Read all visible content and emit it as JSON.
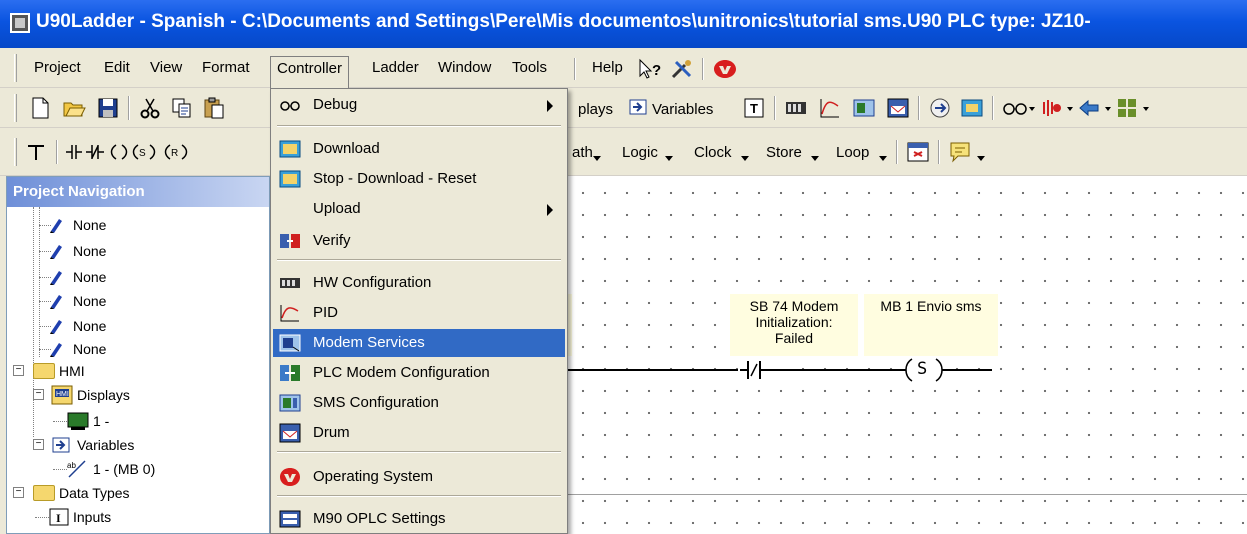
{
  "window": {
    "title": "U90Ladder - Spanish - C:\\Documents and Settings\\Pere\\Mis documentos\\unitronics\\tutorial sms.U90   PLC type: JZ10-"
  },
  "menubar": {
    "items": [
      "Project",
      "Edit",
      "View",
      "Format",
      "Controller",
      "Ladder",
      "Window",
      "Tools",
      "Help"
    ]
  },
  "toolbar1": {
    "text_items": [
      "plays",
      "Variables"
    ]
  },
  "toolbar2": {
    "text_items": [
      "ath",
      "Logic",
      "Clock",
      "Store",
      "Loop"
    ]
  },
  "controller_menu": {
    "items": [
      {
        "label": "Debug",
        "icon": "glasses-icon",
        "submenu": true
      },
      {
        "label": "Download",
        "icon": "download-icon",
        "submenu": false
      },
      {
        "label": "Stop - Download - Reset",
        "icon": "download-icon",
        "submenu": false
      },
      {
        "label": "Upload",
        "icon": "",
        "submenu": true
      },
      {
        "label": "Verify",
        "icon": "verify-icon",
        "submenu": false
      },
      {
        "label": "HW Configuration",
        "icon": "hardware-icon",
        "submenu": false
      },
      {
        "label": "PID",
        "icon": "pid-icon",
        "submenu": false
      },
      {
        "label": "Modem Services",
        "icon": "modem-icon",
        "submenu": false,
        "highlighted": true
      },
      {
        "label": "PLC Modem Configuration",
        "icon": "plc-modem-icon",
        "submenu": false
      },
      {
        "label": "SMS Configuration",
        "icon": "sms-icon",
        "submenu": false
      },
      {
        "label": "Drum",
        "icon": "drum-icon",
        "submenu": false
      },
      {
        "label": "Operating System",
        "icon": "unitronics-logo-icon",
        "submenu": false
      },
      {
        "label": "M90 OPLC Settings",
        "icon": "settings-icon",
        "submenu": false
      }
    ]
  },
  "navigation": {
    "title": "Project Navigation",
    "tree": [
      {
        "label": "None",
        "icon": "pen-icon"
      },
      {
        "label": "None",
        "icon": "pen-icon"
      },
      {
        "label": "None",
        "icon": "pen-icon"
      },
      {
        "label": "None",
        "icon": "pen-icon"
      },
      {
        "label": "None",
        "icon": "pen-icon"
      },
      {
        "label": "None",
        "icon": "pen-icon"
      },
      {
        "label": "HMI",
        "icon": "folder-icon"
      },
      {
        "label": "Displays",
        "icon": "hmi-icon"
      },
      {
        "label": "1 -",
        "icon": "display-icon"
      },
      {
        "label": "Variables",
        "icon": "variables-icon"
      },
      {
        "label": "1 - (MB 0)",
        "icon": "variable-icon"
      },
      {
        "label": "Data Types",
        "icon": "folder-icon"
      },
      {
        "label": "Inputs",
        "icon": "inputs-icon"
      }
    ]
  },
  "ladder": {
    "contact_label": [
      "SB 74  Modem",
      "Initialization:",
      "Failed"
    ],
    "coil_label": [
      "MB 1  Envio sms"
    ],
    "contact_symbol": "\\",
    "coil_symbol": "S"
  },
  "colors": {
    "title_bar": "#0a54e0",
    "menu_highlight": "#316ac5",
    "nav_header": "#6e8fd8",
    "label_fill": "#fffde0",
    "face": "#ece9d8"
  }
}
